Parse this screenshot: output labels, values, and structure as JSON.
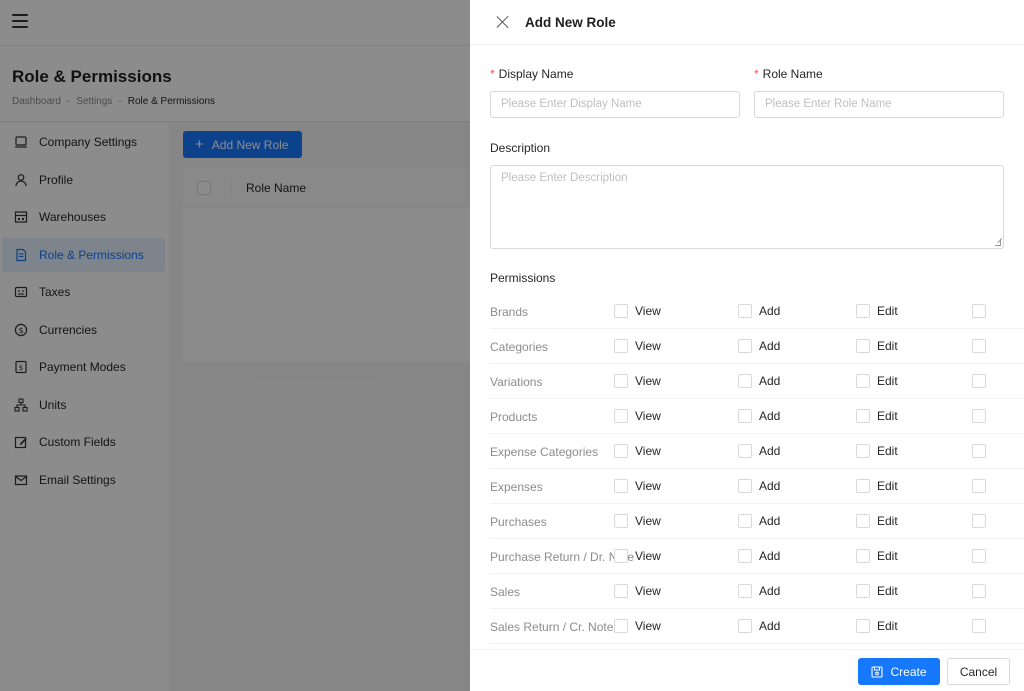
{
  "header": {
    "menu_icon": "hamburger-icon"
  },
  "page": {
    "title": "Role & Permissions",
    "breadcrumb": [
      "Dashboard",
      "-",
      "Settings",
      "-",
      "Role & Permissions"
    ]
  },
  "sidebar": {
    "items": [
      {
        "label": "Company Settings",
        "icon": "laptop-icon"
      },
      {
        "label": "Profile",
        "icon": "user-icon"
      },
      {
        "label": "Warehouses",
        "icon": "warehouse-icon"
      },
      {
        "label": "Role & Permissions",
        "icon": "document-icon",
        "active": true
      },
      {
        "label": "Taxes",
        "icon": "calculator-icon"
      },
      {
        "label": "Currencies",
        "icon": "dollar-icon"
      },
      {
        "label": "Payment Modes",
        "icon": "payment-icon"
      },
      {
        "label": "Units",
        "icon": "cluster-icon"
      },
      {
        "label": "Custom Fields",
        "icon": "edit-icon"
      },
      {
        "label": "Email Settings",
        "icon": "mail-icon"
      }
    ]
  },
  "content": {
    "add_button": "Add New Role",
    "table": {
      "columns": [
        "Role Name"
      ]
    }
  },
  "drawer": {
    "title": "Add New Role",
    "display_name": {
      "label": "Display Name",
      "placeholder": "Please Enter Display Name",
      "required": "*"
    },
    "role_name": {
      "label": "Role Name",
      "placeholder": "Please Enter Role Name",
      "required": "*"
    },
    "description": {
      "label": "Description",
      "placeholder": "Please Enter Description"
    },
    "permissions_title": "Permissions",
    "permission_options": [
      "View",
      "Add",
      "Edit"
    ],
    "permissions": [
      "Brands",
      "Categories",
      "Variations",
      "Products",
      "Expense Categories",
      "Expenses",
      "Purchases",
      "Purchase Return / Dr. Note",
      "Sales",
      "Sales Return / Cr. Note"
    ],
    "create_label": "Create",
    "cancel_label": "Cancel"
  },
  "colors": {
    "primary": "#1677ff",
    "overlay": "rgba(0,0,0,0.45)",
    "required": "#ff4d4f"
  }
}
